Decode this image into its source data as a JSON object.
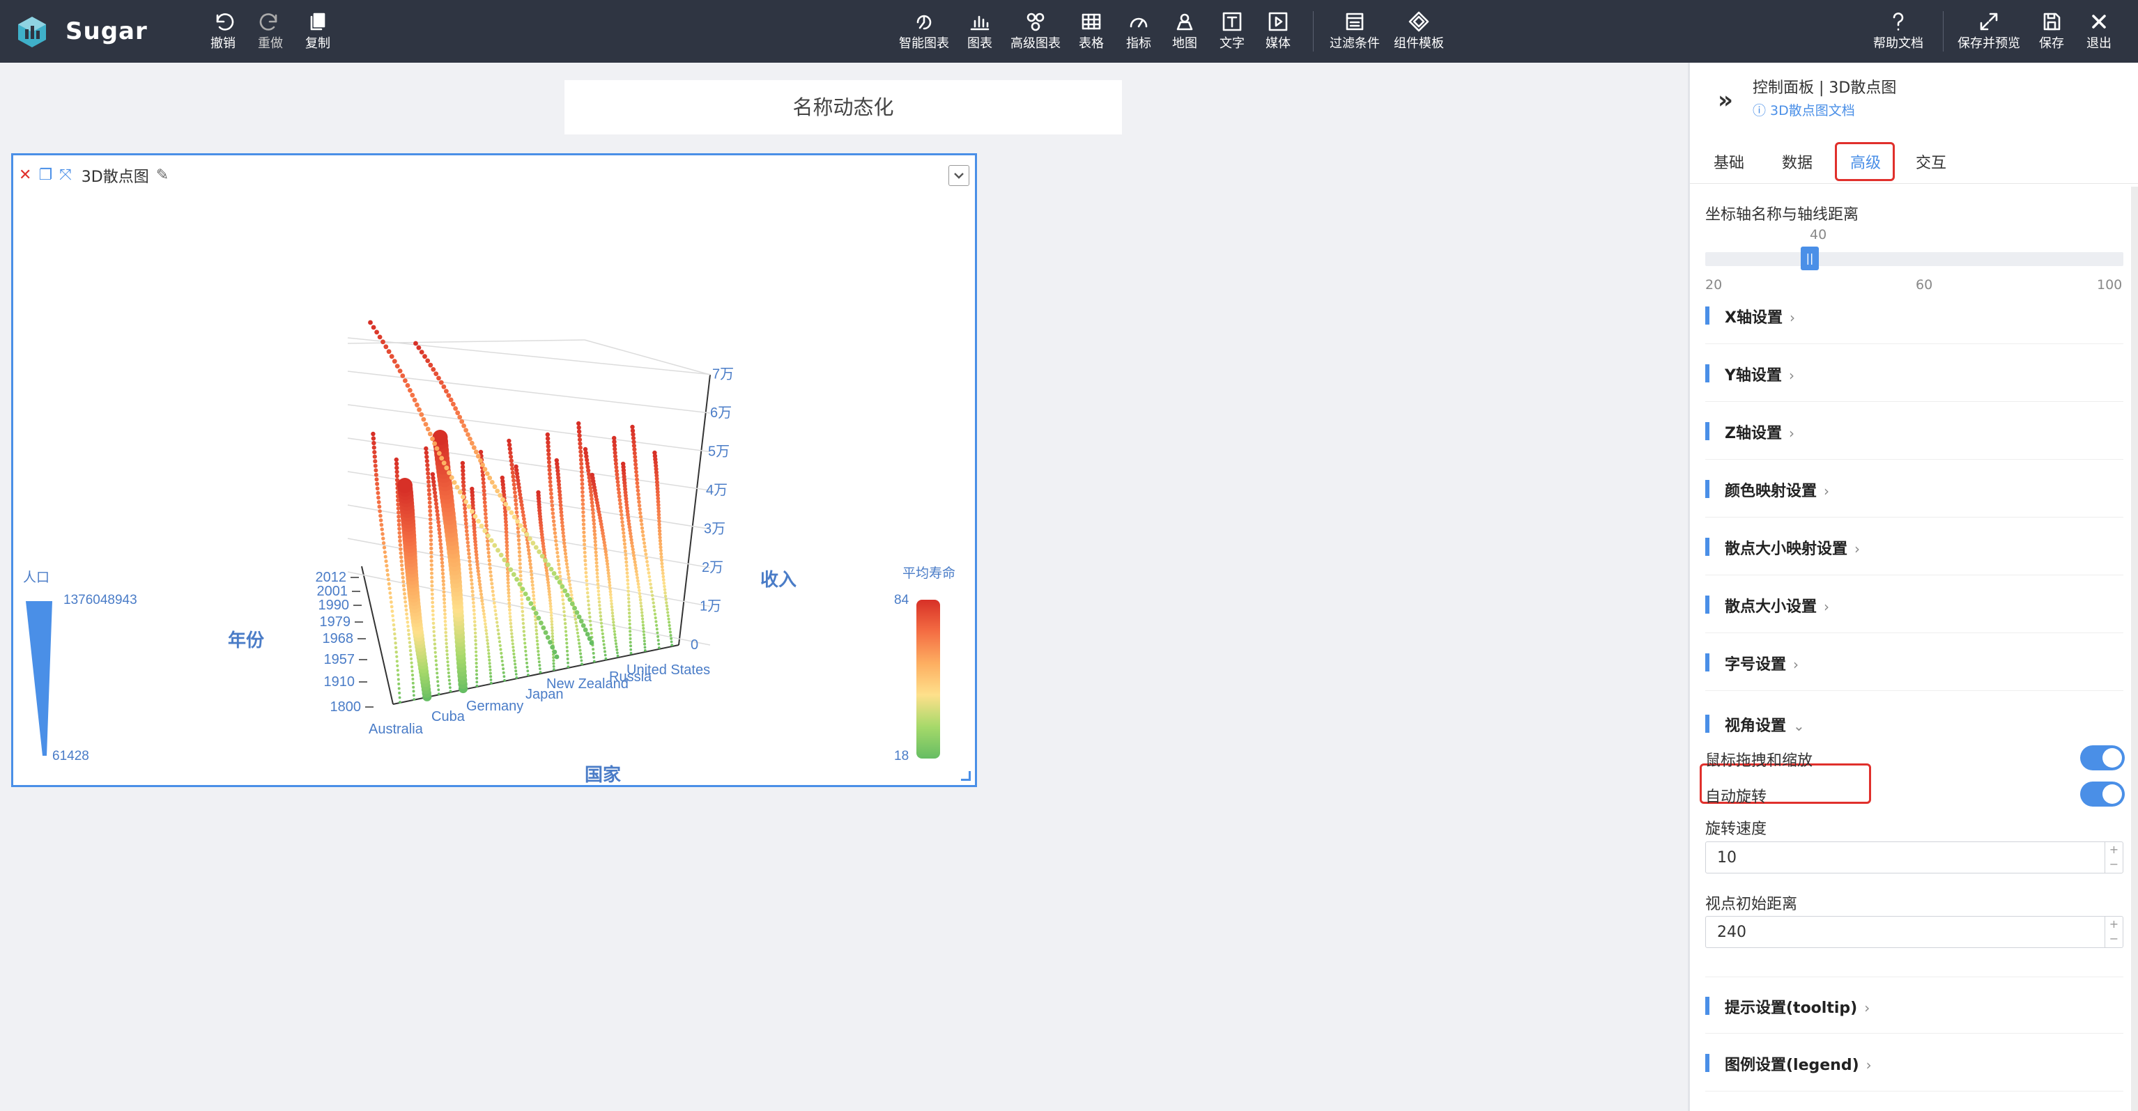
{
  "app": {
    "brand": "Sugar"
  },
  "toolbar": {
    "left": [
      {
        "id": "undo",
        "label": "撤销",
        "icon": "undo-icon"
      },
      {
        "id": "redo",
        "label": "重做",
        "icon": "redo-icon"
      },
      {
        "id": "copy",
        "label": "复制",
        "icon": "copy-icon"
      }
    ],
    "center": [
      {
        "id": "smart-chart",
        "label": "智能图表",
        "icon": "smart-chart-icon"
      },
      {
        "id": "chart",
        "label": "图表",
        "icon": "bar-chart-icon"
      },
      {
        "id": "advanced-chart",
        "label": "高级图表",
        "icon": "advanced-chart-icon"
      },
      {
        "id": "table",
        "label": "表格",
        "icon": "table-icon"
      },
      {
        "id": "metric",
        "label": "指标",
        "icon": "gauge-icon"
      },
      {
        "id": "map",
        "label": "地图",
        "icon": "map-icon"
      },
      {
        "id": "text",
        "label": "文字",
        "icon": "text-icon"
      },
      {
        "id": "media",
        "label": "媒体",
        "icon": "media-icon"
      },
      {
        "id": "filter",
        "label": "过滤条件",
        "icon": "filter-icon"
      },
      {
        "id": "template",
        "label": "组件模板",
        "icon": "template-icon"
      }
    ],
    "right": [
      {
        "id": "help",
        "label": "帮助文档",
        "icon": "help-icon"
      },
      {
        "id": "save-preview",
        "label": "保存并预览",
        "icon": "expand-icon"
      },
      {
        "id": "save",
        "label": "保存",
        "icon": "save-icon"
      },
      {
        "id": "exit",
        "label": "退出",
        "icon": "close-icon"
      }
    ]
  },
  "canvas": {
    "page_title": "名称动态化",
    "card_title": "3D散点图"
  },
  "chart_data": {
    "type": "scatter3d",
    "x_axis": {
      "name": "国家",
      "ticks": [
        "Australia",
        "Cuba",
        "Germany",
        "Japan",
        "New Zealand",
        "Russia",
        "United States"
      ]
    },
    "y_axis": {
      "name": "年份",
      "ticks": [
        "1800",
        "1910",
        "1957",
        "1968",
        "1979",
        "1990",
        "2001",
        "2012"
      ]
    },
    "z_axis": {
      "name": "收入",
      "ticks": [
        "0",
        "1万",
        "2万",
        "3万",
        "4万",
        "5万",
        "6万",
        "7万"
      ]
    },
    "visual_map_size": {
      "title": "人口",
      "max": "1376048943",
      "min": "61428"
    },
    "visual_map_color": {
      "title": "平均寿命",
      "max": "84",
      "min": "18",
      "colors": [
        "#d73027",
        "#f46d43",
        "#fdae61",
        "#fee08b",
        "#a6d96a",
        "#66bd63"
      ]
    }
  },
  "panel": {
    "title": "控制面板 | 3D散点图",
    "doc_link": "3D散点图文档",
    "tabs": [
      "基础",
      "数据",
      "高级",
      "交互"
    ],
    "active_tab": "高级",
    "slider": {
      "label": "坐标轴名称与轴线距离",
      "value": "40",
      "min": "20",
      "mid": "60",
      "max": "100",
      "fraction": 0.25
    },
    "sections": {
      "x": "X轴设置",
      "y": "Y轴设置",
      "z": "Z轴设置",
      "color_map": "颜色映射设置",
      "size_map": "散点大小映射设置",
      "size": "散点大小设置",
      "font": "字号设置",
      "view": "视角设置",
      "tooltip": "提示设置(tooltip)",
      "legend": "图例设置(legend)"
    },
    "view": {
      "drag_zoom_label": "鼠标拖拽和缩放",
      "drag_zoom_on": true,
      "auto_rotate_label": "自动旋转",
      "auto_rotate_on": true,
      "rotate_speed_label": "旋转速度",
      "rotate_speed": "10",
      "distance_label": "视点初始距离",
      "distance": "240"
    }
  }
}
